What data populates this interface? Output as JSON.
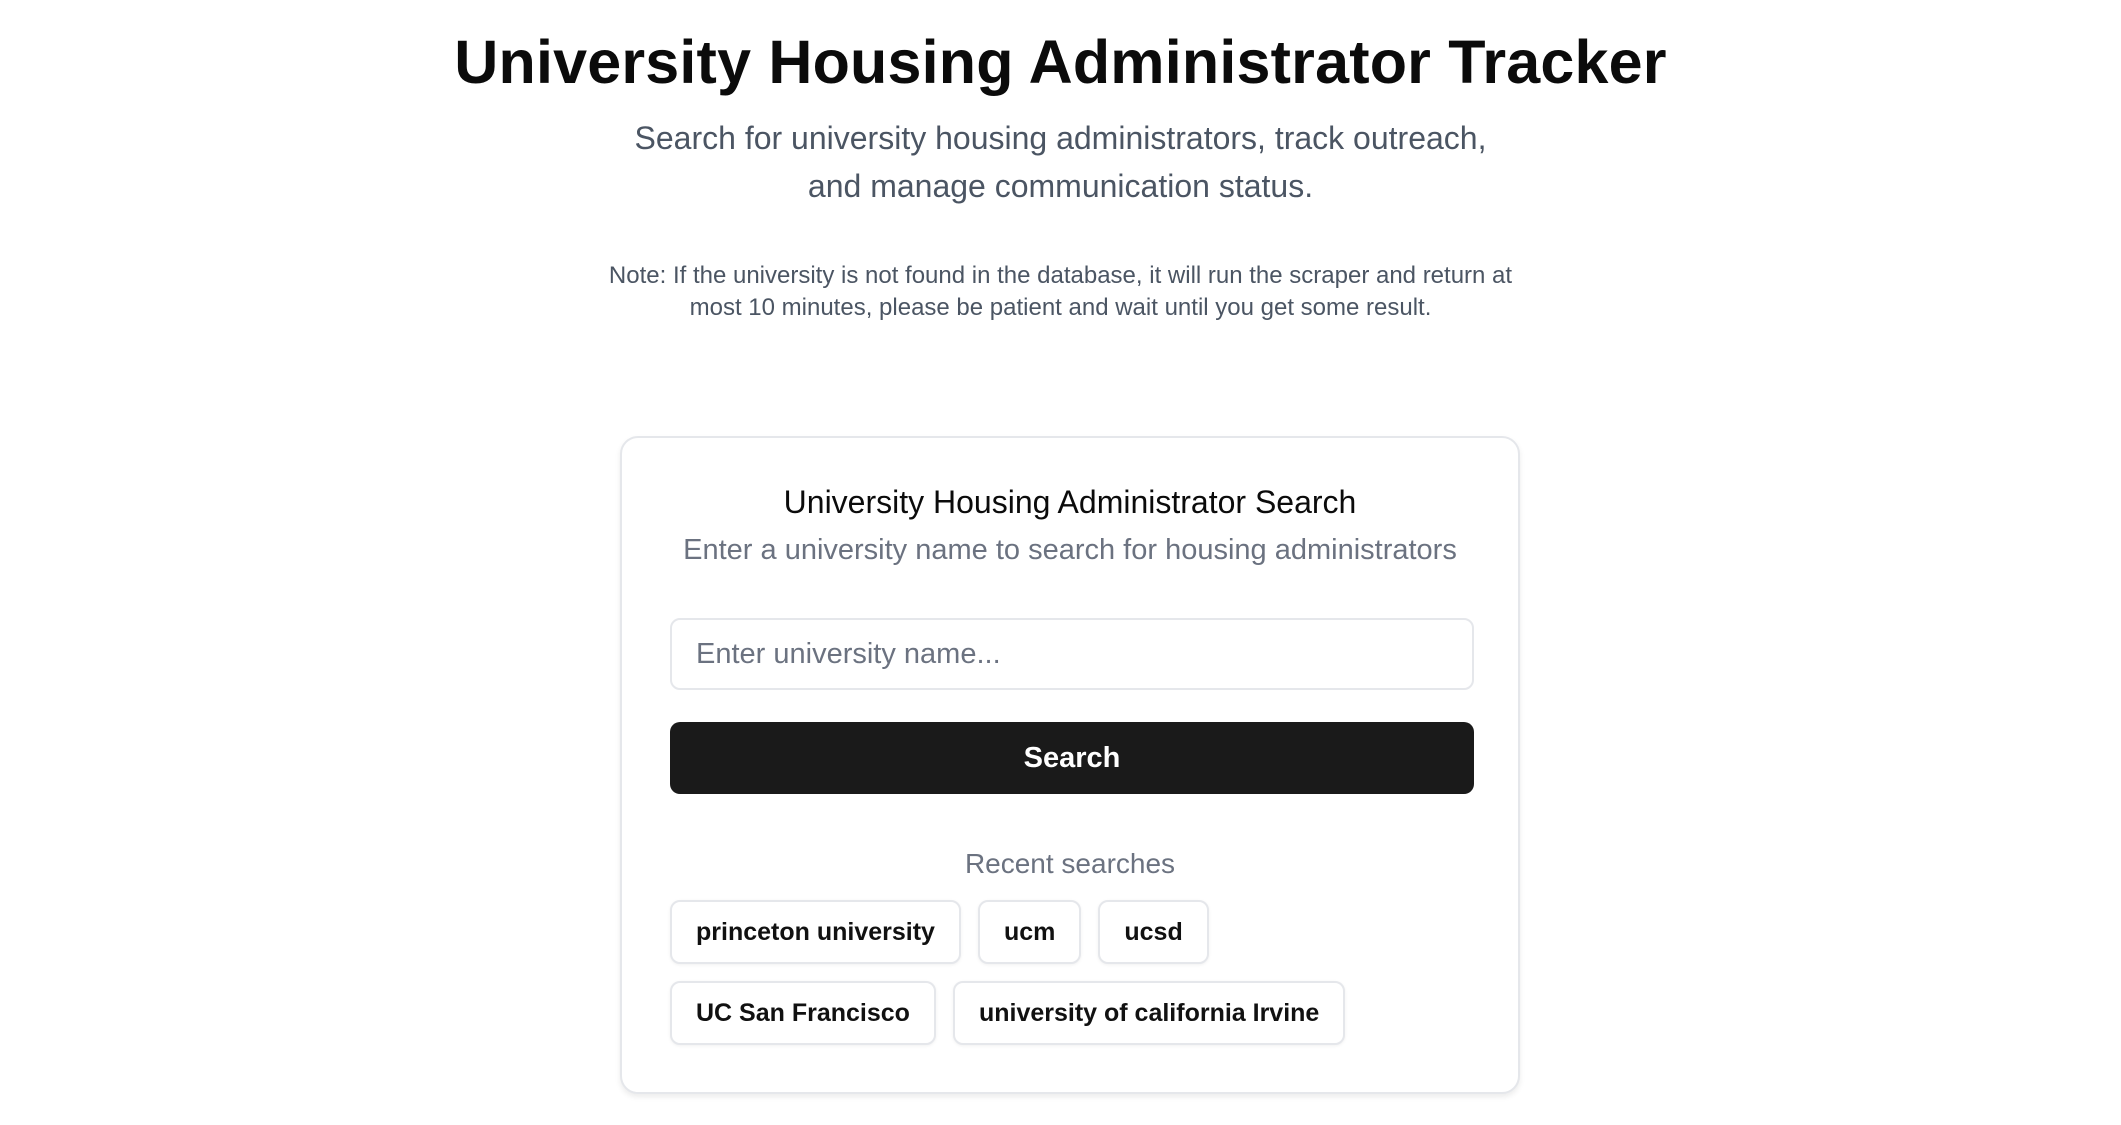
{
  "header": {
    "title": "University Housing Administrator Tracker",
    "subtitle": "Search for university housing administrators, track outreach, and manage communication status.",
    "note": "Note: If the university is not found in the database, it will run the scraper and return at most 10 minutes, please be patient and wait until you get some result."
  },
  "search_card": {
    "title": "University Housing Administrator Search",
    "subtitle": "Enter a university name to search for housing administrators",
    "input_value": "",
    "input_placeholder": "Enter university name...",
    "button_label": "Search",
    "recent_label": "Recent searches",
    "recent_searches": [
      "princeton university",
      "ucm",
      "ucsd",
      "UC San Francisco",
      "university of california Irvine"
    ]
  }
}
